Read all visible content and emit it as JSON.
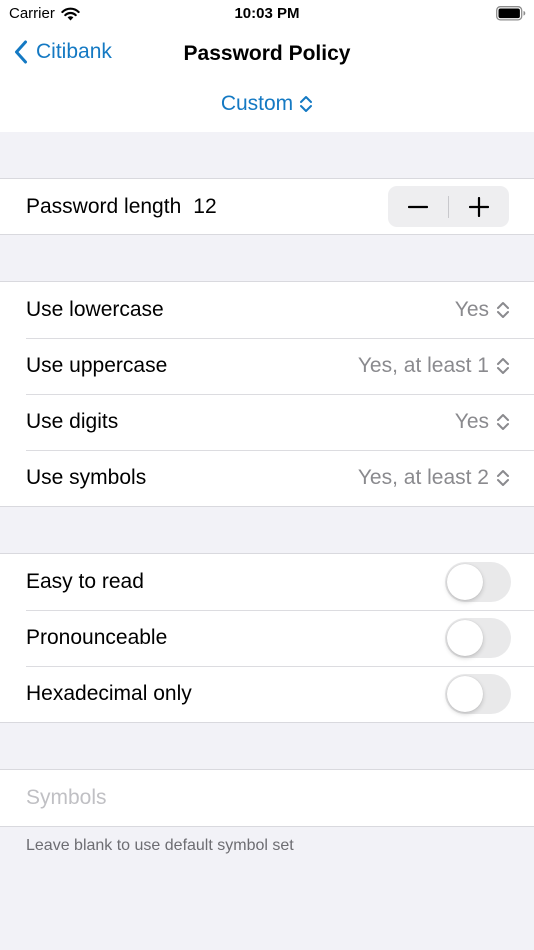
{
  "status_bar": {
    "carrier": "Carrier",
    "time": "10:03 PM"
  },
  "nav": {
    "back_label": "Citibank",
    "title": "Password Policy"
  },
  "mode": {
    "label": "Custom"
  },
  "length": {
    "label": "Password length",
    "value": "12"
  },
  "charsets": [
    {
      "label": "Use lowercase",
      "value": "Yes"
    },
    {
      "label": "Use uppercase",
      "value": "Yes, at least 1"
    },
    {
      "label": "Use digits",
      "value": "Yes"
    },
    {
      "label": "Use symbols",
      "value": "Yes, at least 2"
    }
  ],
  "options": [
    {
      "label": "Easy to read",
      "on": false
    },
    {
      "label": "Pronounceable",
      "on": false
    },
    {
      "label": "Hexadecimal only",
      "on": false
    }
  ],
  "symbols": {
    "placeholder": "Symbols",
    "value": "",
    "footnote": "Leave blank to use default symbol set"
  },
  "colors": {
    "accent": "#1479c3",
    "background": "#f2f2f7",
    "secondary_text": "#8a8a8e"
  },
  "icons": {
    "wifi": "wifi-icon",
    "battery": "battery-icon",
    "back": "chevron-left-icon",
    "updown": "chevron-up-down-icon",
    "minus": "minus-icon",
    "plus": "plus-icon"
  }
}
